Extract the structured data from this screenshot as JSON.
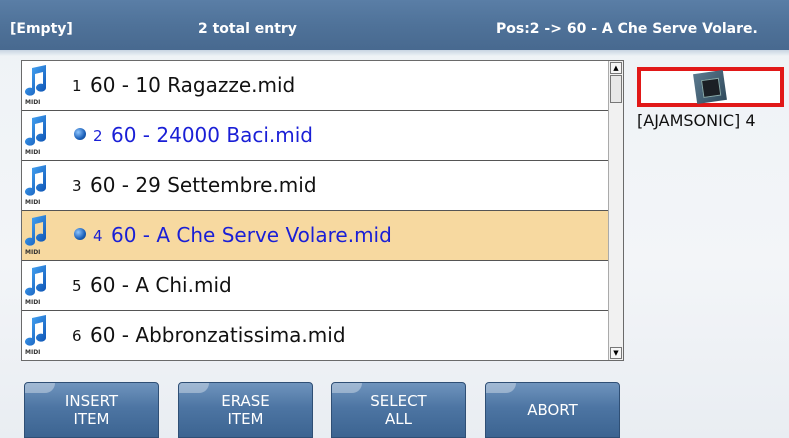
{
  "header": {
    "left": "[Empty]",
    "middle": "2 total entry",
    "right": "Pos:2 -> 60 - A Che Serve Volare."
  },
  "list": {
    "items": [
      {
        "num": "1",
        "name": "60 - 10 Ragazze.mid",
        "marked": false,
        "selected": false
      },
      {
        "num": "2",
        "name": "60 - 24000 Baci.mid",
        "marked": true,
        "selected": false
      },
      {
        "num": "3",
        "name": "60 - 29 Settembre.mid",
        "marked": false,
        "selected": false
      },
      {
        "num": "4",
        "name": "60 - A Che Serve Volare.mid",
        "marked": true,
        "selected": true
      },
      {
        "num": "5",
        "name": "60 - A Chi.mid",
        "marked": false,
        "selected": false
      },
      {
        "num": "6",
        "name": "60 - Abbronzatissima.mid",
        "marked": false,
        "selected": false
      }
    ],
    "icon_label": "MIDI",
    "icon": "music-note-icon"
  },
  "preview": {
    "label": "[AJAMSONIC] 4",
    "icon": "chip-icon"
  },
  "buttons": {
    "insert": [
      "INSERT",
      "ITEM"
    ],
    "erase": [
      "ERASE",
      "ITEM"
    ],
    "select_all": [
      "SELECT",
      "ALL"
    ],
    "abort": "ABORT"
  },
  "colors": {
    "header": "#4f7299",
    "selected_row": "#f7d9a0",
    "marked_text": "#1a1fd6",
    "preview_border": "#e11818"
  }
}
